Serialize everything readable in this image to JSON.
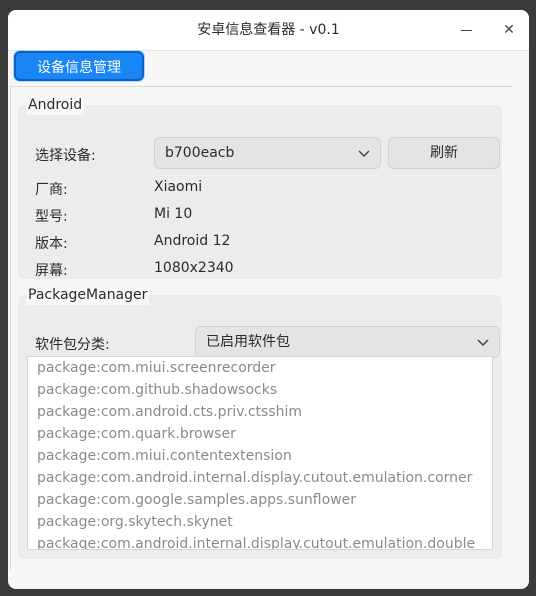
{
  "window": {
    "title": "安卓信息查看器 - v0.1"
  },
  "titlebar": {
    "minimize_icon": "minimize-icon",
    "close_icon": "close-icon",
    "close_glyph": "✕"
  },
  "tabs": [
    {
      "label": "设备信息管理",
      "active": true
    }
  ],
  "android_group": {
    "title": "Android",
    "select_label": "选择设备:",
    "selected_device": "b700eacb",
    "refresh_label": "刷新",
    "fields": [
      {
        "label": "厂商:",
        "value": "Xiaomi"
      },
      {
        "label": "型号:",
        "value": "Mi 10"
      },
      {
        "label": "版本:",
        "value": "Android 12"
      },
      {
        "label": "屏幕:",
        "value": "1080x2340"
      }
    ]
  },
  "package_group": {
    "title": "PackageManager",
    "category_label": "软件包分类:",
    "selected_category": "已启用软件包",
    "packages": [
      "package:com.miui.screenrecorder",
      "package:com.github.shadowsocks",
      "package:com.android.cts.priv.ctsshim",
      "package:com.quark.browser",
      "package:com.miui.contentextension",
      "package:com.android.internal.display.cutout.emulation.corner",
      "package:com.google.samples.apps.sunflower",
      "package:org.skytech.skynet",
      "package:com.android.internal.display.cutout.emulation.double"
    ]
  },
  "colors": {
    "accent": "#1a86f5",
    "accent_border": "#0a62c9"
  }
}
